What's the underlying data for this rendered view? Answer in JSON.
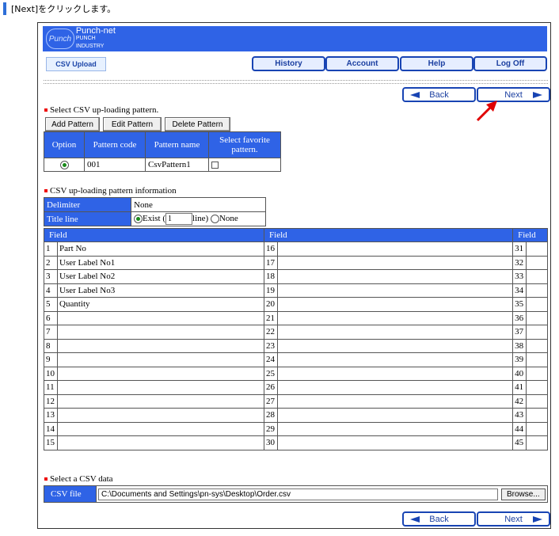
{
  "caption": {
    "text": "[Next]をクリックします。"
  },
  "header": {
    "logo_mark": "Punch",
    "logo_line1": "Punch-net",
    "logo_line2": "PUNCH INDUSTRY"
  },
  "nav": {
    "tag": "CSV Upload",
    "history": "History",
    "account": "Account",
    "help": "Help",
    "logoff": "Log Off"
  },
  "wizard": {
    "back": "Back",
    "next": "Next"
  },
  "pattern": {
    "section_title": "Select CSV up-loading pattern.",
    "add": "Add Pattern",
    "edit": "Edit Pattern",
    "delete": "Delete Pattern",
    "headers": {
      "option": "Option",
      "code": "Pattern code",
      "name": "Pattern name",
      "favorite": "Select favorite pattern."
    },
    "row": {
      "code": "001",
      "name": "CsvPattern1"
    }
  },
  "info": {
    "section_title": "CSV up-loading pattern information",
    "delimiter_label": "Delimiter",
    "delimiter_value": "None",
    "title_label": "Title line",
    "exist": "Exist (",
    "lines": "1",
    "line_suffix": "line)",
    "none": "None"
  },
  "fields": {
    "header": "Field",
    "col1": [
      "Part No",
      "User Label No1",
      "User Label No2",
      "User Label No3",
      "Quantity",
      "",
      "",
      "",
      "",
      "",
      "",
      "",
      "",
      "",
      ""
    ]
  },
  "csvdata": {
    "section_title": "Select a CSV data",
    "label": "CSV file",
    "path": "C:\\Documents and Settings\\pn-sys\\Desktop\\Order.csv",
    "browse": "Browse..."
  }
}
